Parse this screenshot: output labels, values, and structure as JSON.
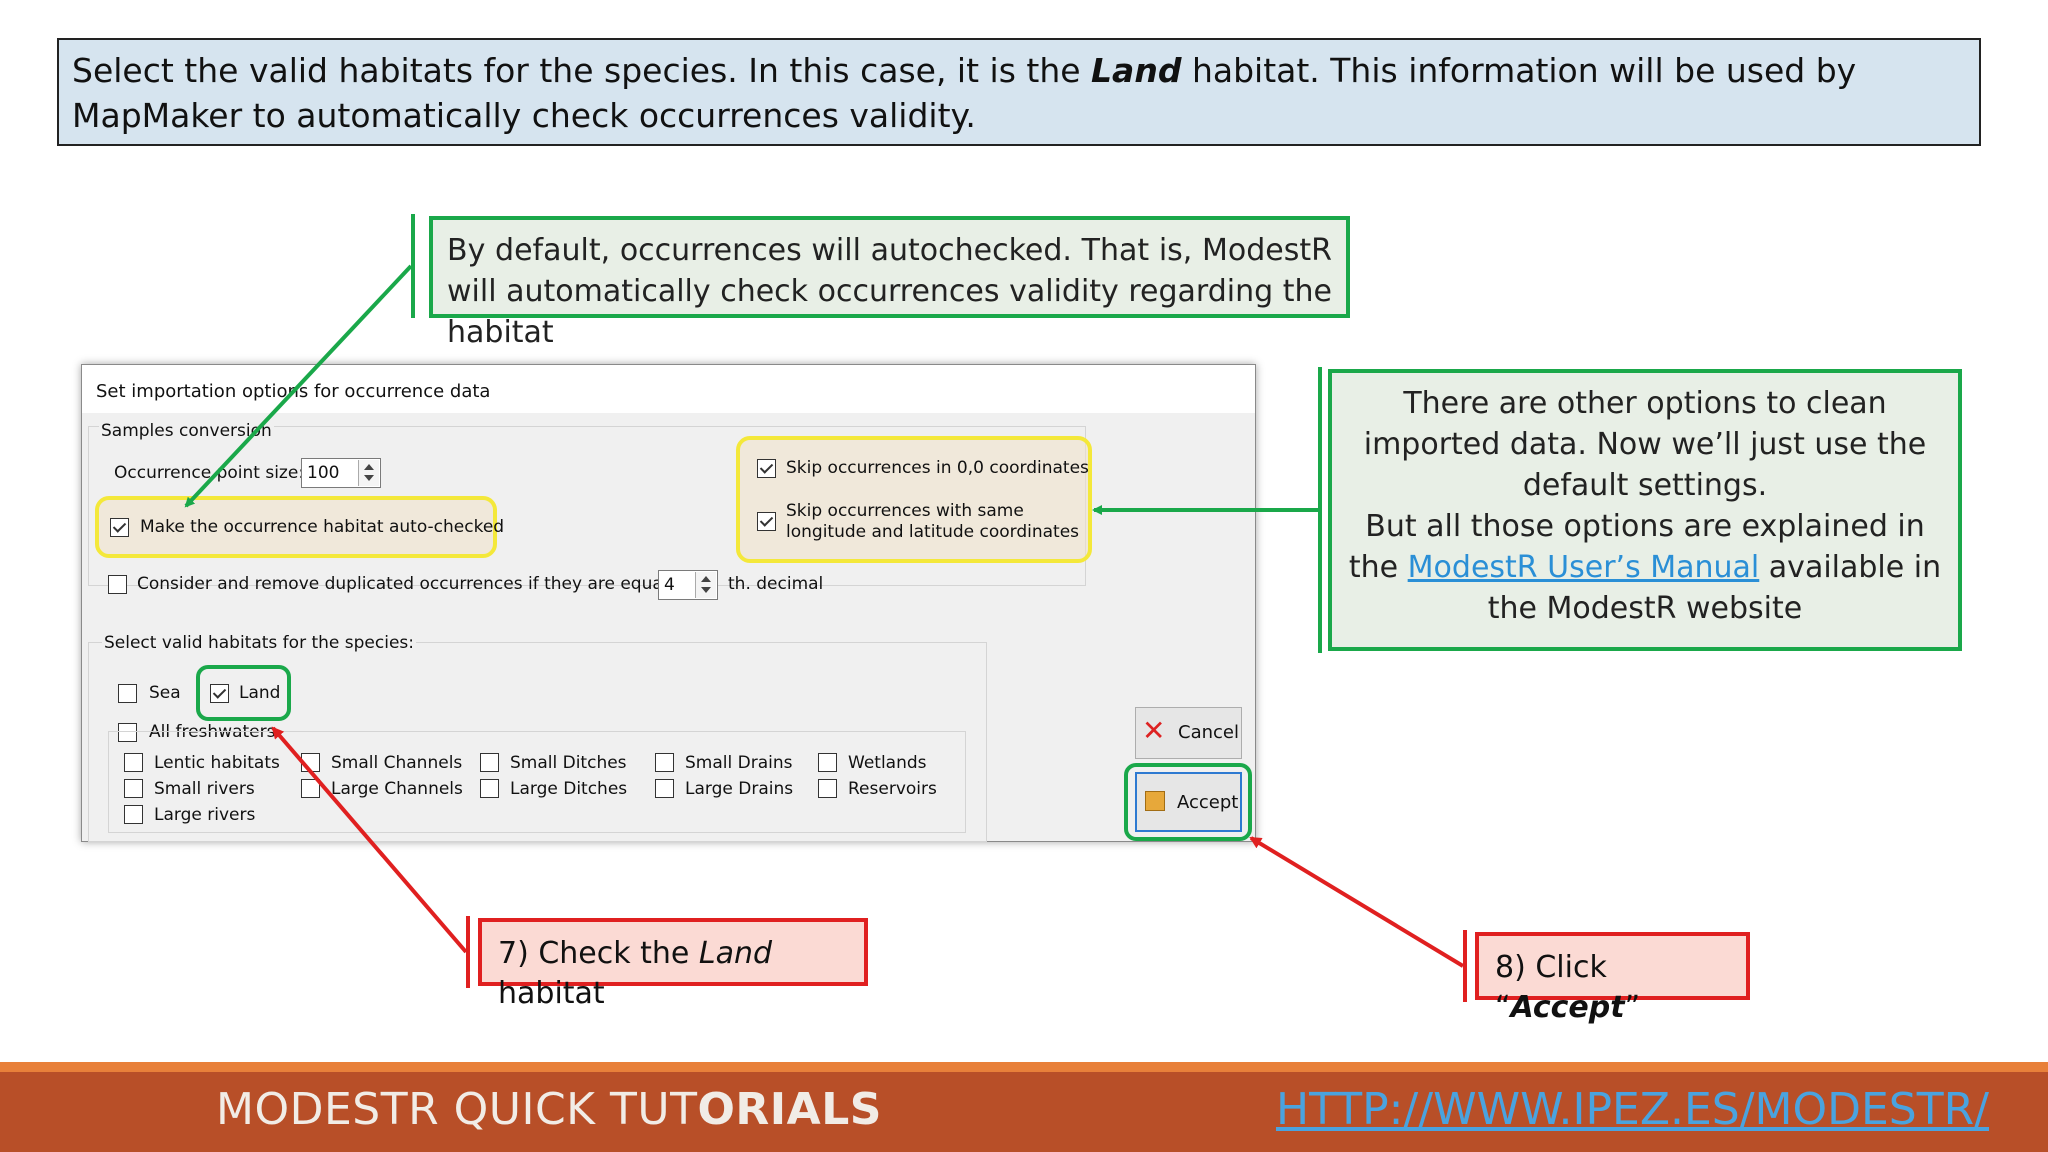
{
  "banner": {
    "text_before": "Select the valid habitats for the species. In this case, it is the ",
    "text_emphasis": "Land",
    "text_after": " habitat. This information will be used by MapMaker to automatically check occurrences validity."
  },
  "callouts": {
    "autocheck": "By default, occurrences will autochecked. That is, ModestR will automatically check occurrences validity regarding the habitat",
    "other_options": {
      "line1": "There are other options to clean imported data. Now we’ll just use the default settings.",
      "line2_before": "But all those options are explained in the ",
      "link": "ModestR User’s Manual",
      "line2_after": " available in the ModestR website"
    },
    "step7": {
      "before": "7) Check the ",
      "emphasis": "Land",
      "after": " habitat"
    },
    "step8": {
      "before": "8) Click “",
      "emphasis": "Accept",
      "after": "”"
    }
  },
  "dialog": {
    "title": "Set importation options for occurrence data",
    "samples_group": "Samples conversion",
    "point_size_label": "Occurrence point size:",
    "point_size_value": "100",
    "autochecked_label": "Make the occurrence habitat auto-checked",
    "autochecked": true,
    "skip_zero_label": "Skip occurrences in 0,0 coordinates",
    "skip_zero": true,
    "skip_same_label_1": "Skip occurrences with same",
    "skip_same_label_2": "longitude and latitude coordinates",
    "skip_same": true,
    "duplicates_label": "Consider and remove duplicated occurrences if they are equal until",
    "duplicates": false,
    "decimal_value": "4",
    "decimal_suffix": "th. decimal",
    "habitats_group": "Select valid habitats for the species:",
    "sea_label": "Sea",
    "land_label": "Land",
    "all_fresh_label": "All freshwaters",
    "fresh": {
      "lentic": "Lentic habitats",
      "small_rivers": "Small rivers",
      "large_rivers": "Large rivers",
      "small_channels": "Small Channels",
      "large_channels": "Large Channels",
      "small_ditches": "Small Ditches",
      "large_ditches": "Large Ditches",
      "small_drains": "Small Drains",
      "large_drains": "Large Drains",
      "wetlands": "Wetlands",
      "reservoirs": "Reservoirs"
    },
    "cancel_label": "Cancel",
    "accept_label": "Accept"
  },
  "footer": {
    "title_light": "MODESTR QUICK TUT",
    "title_bold": "ORIALS",
    "url": "HTTP://WWW.IPEZ.ES/MODESTR/"
  },
  "colors": {
    "green": "#1aa84a",
    "red": "#e02020",
    "yellow": "#f4e83a",
    "footer_bg": "#b84f28",
    "footer_stripe": "#e8803a",
    "link": "#2a8fd6"
  }
}
